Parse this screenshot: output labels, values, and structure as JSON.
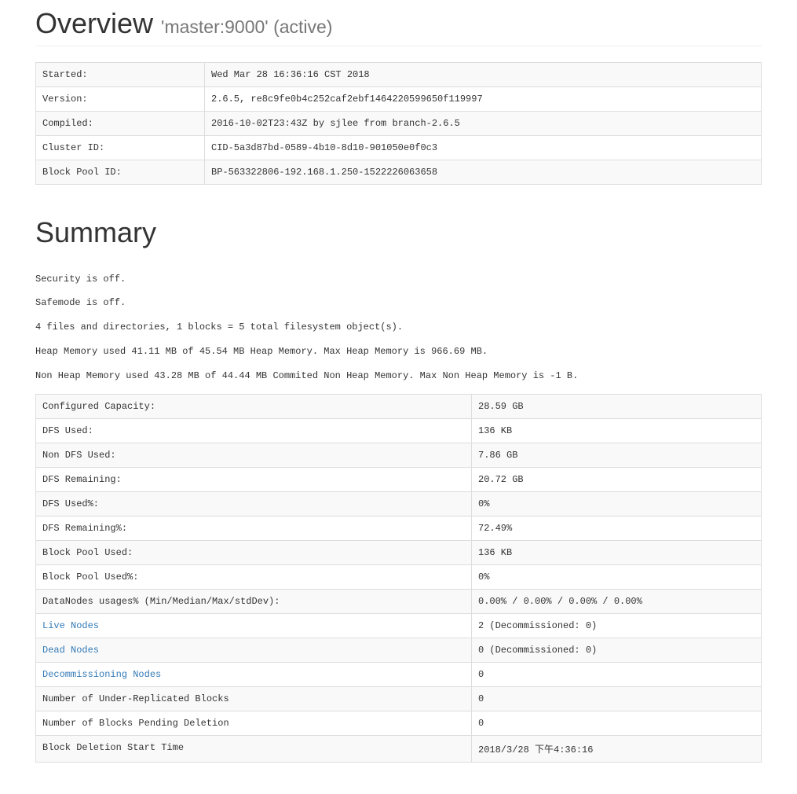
{
  "header": {
    "title": "Overview",
    "subtitle": "'master:9000' (active)"
  },
  "overview_rows": [
    {
      "label": "Started:",
      "value": "Wed Mar 28 16:36:16 CST 2018"
    },
    {
      "label": "Version:",
      "value": "2.6.5, re8c9fe0b4c252caf2ebf1464220599650f119997"
    },
    {
      "label": "Compiled:",
      "value": "2016-10-02T23:43Z by sjlee from branch-2.6.5"
    },
    {
      "label": "Cluster ID:",
      "value": "CID-5a3d87bd-0589-4b10-8d10-901050e0f0c3"
    },
    {
      "label": "Block Pool ID:",
      "value": "BP-563322806-192.168.1.250-1522226063658"
    }
  ],
  "summary_heading": "Summary",
  "info_lines": [
    "Security is off.",
    "Safemode is off.",
    "4 files and directories, 1 blocks = 5 total filesystem object(s).",
    "Heap Memory used 41.11 MB of 45.54 MB Heap Memory. Max Heap Memory is 966.69 MB.",
    "Non Heap Memory used 43.28 MB of 44.44 MB Commited Non Heap Memory. Max Non Heap Memory is -1 B."
  ],
  "summary_rows": [
    {
      "label": "Configured Capacity:",
      "value": "28.59 GB",
      "link": false
    },
    {
      "label": "DFS Used:",
      "value": "136 KB",
      "link": false
    },
    {
      "label": "Non DFS Used:",
      "value": "7.86 GB",
      "link": false
    },
    {
      "label": "DFS Remaining:",
      "value": "20.72 GB",
      "link": false
    },
    {
      "label": "DFS Used%:",
      "value": "0%",
      "link": false
    },
    {
      "label": "DFS Remaining%:",
      "value": "72.49%",
      "link": false
    },
    {
      "label": "Block Pool Used:",
      "value": "136 KB",
      "link": false
    },
    {
      "label": "Block Pool Used%:",
      "value": "0%",
      "link": false
    },
    {
      "label": "DataNodes usages% (Min/Median/Max/stdDev):",
      "value": "0.00% / 0.00% / 0.00% / 0.00%",
      "link": false
    },
    {
      "label": "Live Nodes",
      "value": "2 (Decommissioned: 0)",
      "link": true
    },
    {
      "label": "Dead Nodes",
      "value": "0 (Decommissioned: 0)",
      "link": true
    },
    {
      "label": "Decommissioning Nodes",
      "value": "0",
      "link": true
    },
    {
      "label": "Number of Under-Replicated Blocks",
      "value": "0",
      "link": false
    },
    {
      "label": "Number of Blocks Pending Deletion",
      "value": "0",
      "link": false
    },
    {
      "label": "Block Deletion Start Time",
      "value": "2018/3/28 下午4:36:16",
      "link": false
    }
  ]
}
